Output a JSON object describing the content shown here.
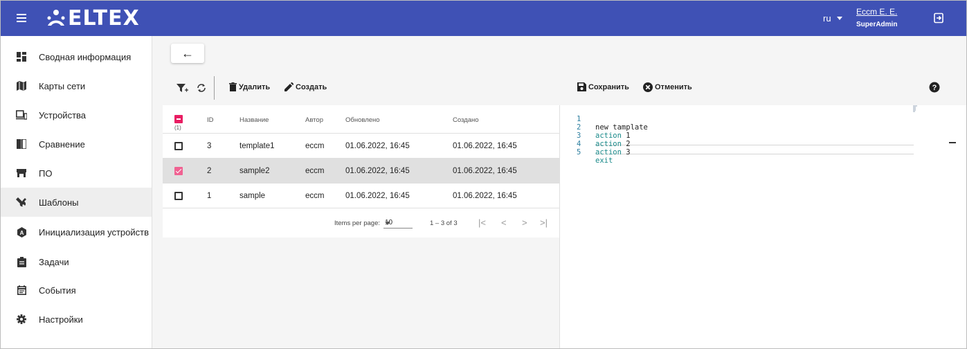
{
  "header": {
    "brand": "ELTEX",
    "language": "ru",
    "user_name": "Eccm E. E.",
    "user_role": "SuperAdmin",
    "bg_color": "#3f51b5"
  },
  "sidebar": {
    "items": [
      {
        "label": "Сводная информация",
        "icon": "dashboard-icon"
      },
      {
        "label": "Карты сети",
        "icon": "map-icon"
      },
      {
        "label": "Устройства",
        "icon": "devices-icon"
      },
      {
        "label": "Сравнение",
        "icon": "compare-icon"
      },
      {
        "label": "ПО",
        "icon": "software-icon"
      },
      {
        "label": "Шаблоны",
        "icon": "wrench-icon"
      },
      {
        "label": "Инициализация устройств",
        "icon": "init-icon"
      },
      {
        "label": "Задачи",
        "icon": "assignment-icon"
      },
      {
        "label": "События",
        "icon": "event-icon"
      },
      {
        "label": "Настройки",
        "icon": "gear-icon"
      }
    ],
    "active_index": 5
  },
  "toolbar": {
    "back_label": "←",
    "delete_label": "Удалить",
    "create_label": "Создать",
    "save_label": "Сохранить",
    "cancel_label": "Отменить"
  },
  "table": {
    "selected_count": "(1)",
    "columns": [
      "ID",
      "Название",
      "Автор",
      "Обновлено",
      "Создано"
    ],
    "rows": [
      {
        "id": "3",
        "name": "template1",
        "author": "eccm",
        "updated": "01.06.2022, 16:45",
        "created": "01.06.2022, 16:45",
        "selected": false
      },
      {
        "id": "2",
        "name": "sample2",
        "author": "eccm",
        "updated": "01.06.2022, 16:45",
        "created": "01.06.2022, 16:45",
        "selected": true
      },
      {
        "id": "1",
        "name": "sample",
        "author": "eccm",
        "updated": "01.06.2022, 16:45",
        "created": "01.06.2022, 16:45",
        "selected": false
      }
    ],
    "paginator": {
      "items_per_page_label": "Items per page:",
      "items_per_page": "10",
      "range": "1 – 3 of 3"
    }
  },
  "editor": {
    "lines": [
      {
        "n": "1",
        "text": "new tamplate"
      },
      {
        "n": "2",
        "kw": "action",
        "num": "1"
      },
      {
        "n": "3",
        "kw": "action",
        "num": "2"
      },
      {
        "n": "4",
        "kw": "action",
        "num": "3"
      },
      {
        "n": "5",
        "kw": "exit",
        "num": ""
      }
    ]
  }
}
